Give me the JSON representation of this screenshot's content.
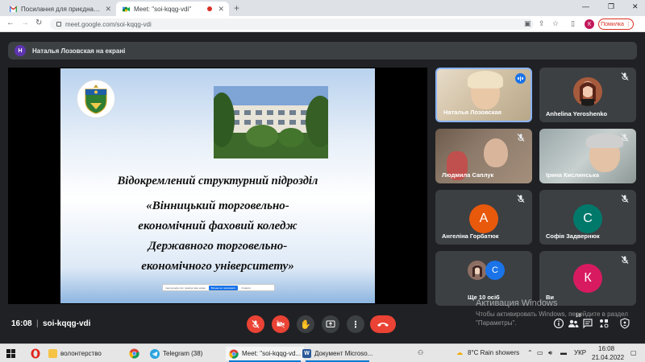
{
  "browser": {
    "tabs": [
      {
        "title": "Посилання для приєднання до",
        "active": false
      },
      {
        "title": "Meet: \"soi-kqqg-vdi\"",
        "active": true
      }
    ],
    "url": "meet.google.com/soi-kqqg-vdi",
    "profile_initial": "К",
    "error_label": "Помилка"
  },
  "presenting": {
    "avatar_initial": "Н",
    "text": "Наталья Лозовская на екрані"
  },
  "slide": {
    "line1": "Відокремлений структурний підрозділ",
    "line2": "«Вінницький торговельно-",
    "line3": "економічний фаховий коледж",
    "line4": "Державного торговельно-",
    "line5": "економічного університету»",
    "share_bar_text": "meet.google.com показує ваш екран",
    "share_bar_stop": "Більше не показувати",
    "share_bar_hide": "Сховати"
  },
  "participants": [
    {
      "name": "Наталья Лозовская",
      "type": "video",
      "speaking": true
    },
    {
      "name": "Anhelina Yeroshenko",
      "type": "photo",
      "muted": true
    },
    {
      "name": "Людмила Саплук",
      "type": "video",
      "muted": true
    },
    {
      "name": "Ірина Кислинська",
      "type": "video",
      "muted": true
    },
    {
      "name": "Ангеліна Горбатюк",
      "type": "avatar",
      "initial": "А",
      "color": "#e8590c",
      "muted": true
    },
    {
      "name": "Софія Задвернюк",
      "type": "avatar",
      "initial": "С",
      "color": "#00796b",
      "muted": true
    },
    {
      "name": "Ще 10 осіб",
      "type": "group",
      "initial": "С",
      "color": "#1a73e8"
    },
    {
      "name": "Ви",
      "type": "avatar",
      "initial": "К",
      "color": "#d81b60",
      "muted": true
    }
  ],
  "meeting": {
    "time": "16:08",
    "separator": "|",
    "code": "soi-kqqg-vdi",
    "participants_badge": "18"
  },
  "watermark": {
    "title": "Активация Windows",
    "body": "Чтобы активировать Windows, перейдите в раздел \"Параметры\"."
  },
  "taskbar": {
    "items": [
      {
        "label": "волонтерство"
      },
      {
        "label": "Telegram (38)"
      },
      {
        "label": "Meet: \"soi-kqqg-vd..."
      },
      {
        "label": "Документ Microso..."
      }
    ],
    "weather": "8°C  Rain showers",
    "lang": "УКР",
    "time": "16:08",
    "date": "21.04.2022"
  },
  "colors": {
    "meet_bg": "#202124",
    "tile_bg": "#3c4043",
    "danger": "#ea4335",
    "accent": "#1a73e8"
  }
}
